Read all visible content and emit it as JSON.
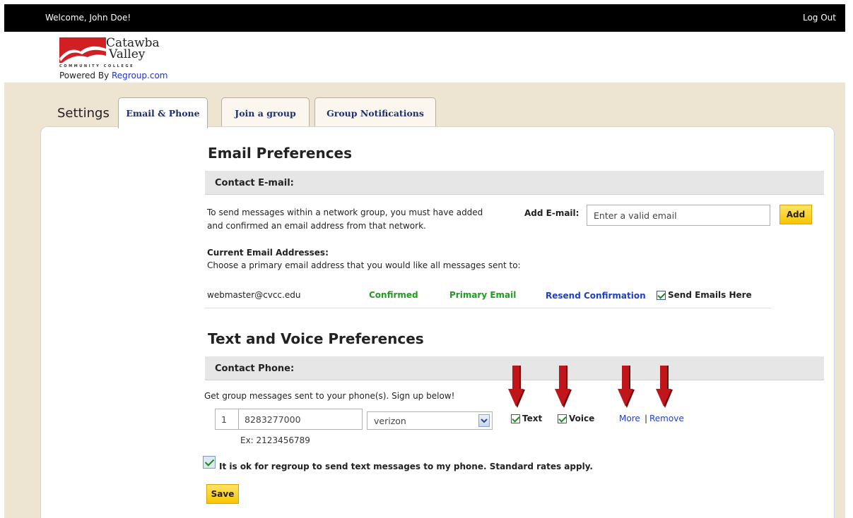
{
  "header": {
    "welcome": "Welcome, John Doe!",
    "logout": "Log Out"
  },
  "brand": {
    "name_line1": "Catawba",
    "name_line2": "Valley",
    "subtitle": "COMMUNITY COLLEGE",
    "powered_by": "Powered By",
    "powered_link": "Regroup.com"
  },
  "nav": {
    "settings_label": "Settings",
    "tabs": [
      {
        "label": "Email & Phone",
        "active": true
      },
      {
        "label": "Join a group",
        "active": false
      },
      {
        "label": "Group Notifications",
        "active": false
      }
    ]
  },
  "email_section": {
    "title": "Email Preferences",
    "bar_label": "Contact E-mail:",
    "description_line1": "To send messages within a network group, you must have added",
    "description_line2": "and confirmed an email address from that network.",
    "add_label": "Add E-mail:",
    "input_placeholder": "Enter a valid email",
    "add_button": "Add",
    "current_heading": "Current Email Addresses:",
    "current_instruction": "Choose a primary email address that you would like all messages sent to:",
    "addresses": [
      {
        "email": "webmaster@cvcc.edu",
        "status": "Confirmed",
        "primary": "Primary Email",
        "resend": "Resend Confirmation",
        "send_here_label": "Send Emails Here",
        "send_here_checked": true
      }
    ]
  },
  "phone_section": {
    "title": "Text and Voice Preferences",
    "bar_label": "Contact Phone:",
    "instruction": "Get group messages sent to your phone(s). Sign up below!",
    "phones": [
      {
        "country_code": "1",
        "number": "8283277000",
        "carrier": "verizon",
        "text_label": "Text",
        "text_checked": true,
        "voice_label": "Voice",
        "voice_checked": true,
        "more_link": "More",
        "separator": "|",
        "remove_link": "Remove"
      }
    ],
    "example": "Ex: 2123456789",
    "consent_label": "It is ok for regroup to send text messages to my phone. Standard rates apply.",
    "consent_checked": true,
    "save_button": "Save"
  },
  "colors": {
    "topbar": "#000000",
    "page_background": "#ede4d2",
    "tab_text": "#1f2f6b",
    "confirmed_green": "#229a22",
    "link_blue": "#1f3fc8",
    "button_yellow": "#f7c500",
    "annotation_arrow": "#c0151b"
  },
  "icons": {
    "dropdown": "chevron-down-icon",
    "annotation": "red-down-arrow-icon"
  }
}
